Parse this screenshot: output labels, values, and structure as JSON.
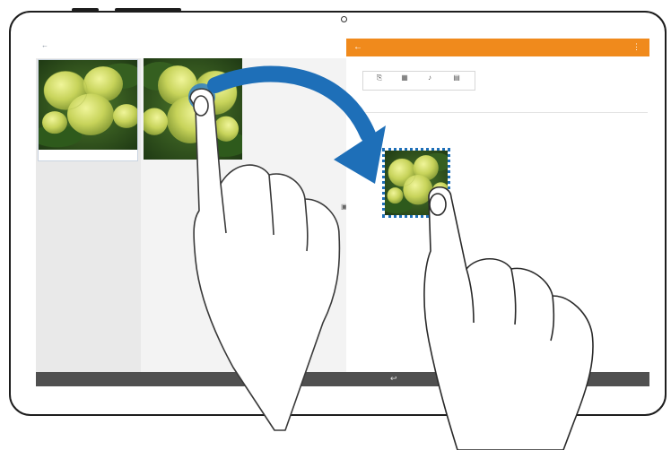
{
  "screen": {
    "left_app": {
      "topbar_back_icon": "arrow-left-icon",
      "topbar_title": "",
      "topbar_right_labels": [
        "",
        ""
      ],
      "photos": [
        {
          "name": "hydrangea-photo-1",
          "icon": "image-icon",
          "caption": ""
        },
        {
          "name": "hydrangea-photo-2",
          "icon": "image-icon"
        }
      ]
    },
    "right_app": {
      "header_title": "",
      "header_color": "#f08a1c",
      "back_icon": "arrow-left-icon",
      "more_icon": "more-icon",
      "toolbar": [
        {
          "icon": "attach-icon",
          "label": ""
        },
        {
          "icon": "image-icon",
          "label": ""
        },
        {
          "icon": "mic-icon",
          "label": ""
        },
        {
          "icon": "table-icon",
          "label": ""
        }
      ],
      "field_labels": [
        "",
        ""
      ],
      "drop_target_icon": "dropped-image-icon"
    },
    "navbar": {
      "back_icon": "back-nav-icon"
    }
  },
  "gesture": {
    "type": "drag-and-drop",
    "arrow_color": "#1e6fb8",
    "source": "hydrangea-photo-2",
    "target": "memo-drop-target"
  }
}
